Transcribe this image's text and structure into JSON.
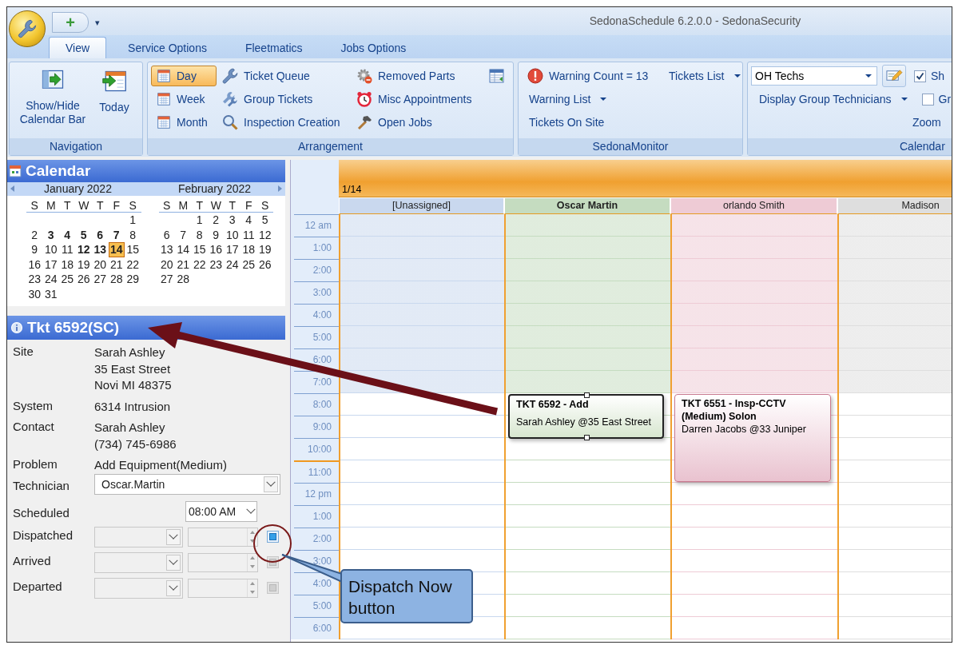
{
  "window": {
    "title": "SedonaSchedule 6.2.0.0 - SedonaSecurity"
  },
  "quick_access": {
    "add_label": "+",
    "customize_label": "▾"
  },
  "tabs": [
    {
      "label": "View",
      "selected": true
    },
    {
      "label": "Service Options",
      "selected": false
    },
    {
      "label": "Fleetmatics",
      "selected": false
    },
    {
      "label": "Jobs Options",
      "selected": false
    }
  ],
  "ribbon": {
    "navigation": {
      "label": "Navigation",
      "buttons": [
        "Show/Hide Calendar Bar",
        "Today"
      ]
    },
    "arrangement": {
      "label": "Arrangement",
      "views": [
        {
          "label": "Day",
          "selected": true
        },
        {
          "label": "Week",
          "selected": false
        },
        {
          "label": "Month",
          "selected": false
        }
      ],
      "actions": [
        "Ticket Queue",
        "Group Tickets",
        "Inspection Creation",
        "Removed Parts",
        "Misc Appointments",
        "Open Jobs"
      ]
    },
    "monitor": {
      "label": "SedonaMonitor",
      "warning_count": "Warning Count = 13",
      "tickets_list": "Tickets List",
      "warning_list": "Warning List",
      "tickets_on_site": "Tickets On Site"
    },
    "calendar": {
      "label": "Calendar",
      "group_combo": "OH Techs",
      "display_group": "Display Group Technicians",
      "zoom": "Zoom",
      "options": [
        {
          "label": "Sh",
          "checked": true
        },
        {
          "label": "Gr",
          "checked": false
        }
      ]
    }
  },
  "calendar_panel": {
    "title": "Calendar",
    "months": [
      {
        "title": "January 2022",
        "weekdays": [
          "S",
          "M",
          "T",
          "W",
          "T",
          "F",
          "S"
        ],
        "weeks": [
          [
            {
              "day": "1",
              "bold": false,
              "selected": false
            }
          ],
          [
            {
              "day": "2",
              "bold": false,
              "selected": false
            },
            {
              "day": "3",
              "bold": true,
              "selected": false
            },
            {
              "day": "4",
              "bold": true,
              "selected": false
            },
            {
              "day": "5",
              "bold": true,
              "selected": false
            },
            {
              "day": "6",
              "bold": true,
              "selected": false
            },
            {
              "day": "7",
              "bold": true,
              "selected": false
            },
            {
              "day": "8",
              "bold": false,
              "selected": false
            }
          ],
          [
            {
              "day": "9",
              "bold": false,
              "selected": false
            },
            {
              "day": "10",
              "bold": false,
              "selected": false
            },
            {
              "day": "11",
              "bold": false,
              "selected": false
            },
            {
              "day": "12",
              "bold": true,
              "selected": false
            },
            {
              "day": "13",
              "bold": true,
              "selected": false
            },
            {
              "day": "14",
              "bold": true,
              "selected": true
            },
            {
              "day": "15",
              "bold": false,
              "selected": false
            }
          ],
          [
            {
              "day": "16",
              "bold": false,
              "selected": false
            },
            {
              "day": "17",
              "bold": false,
              "selected": false
            },
            {
              "day": "18",
              "bold": false,
              "selected": false
            },
            {
              "day": "19",
              "bold": false,
              "selected": false
            },
            {
              "day": "20",
              "bold": false,
              "selected": false
            },
            {
              "day": "21",
              "bold": false,
              "selected": false
            },
            {
              "day": "22",
              "bold": false,
              "selected": false
            }
          ],
          [
            {
              "day": "23",
              "bold": false,
              "selected": false
            },
            {
              "day": "24",
              "bold": false,
              "selected": false
            },
            {
              "day": "25",
              "bold": false,
              "selected": false
            },
            {
              "day": "26",
              "bold": false,
              "selected": false
            },
            {
              "day": "27",
              "bold": false,
              "selected": false
            },
            {
              "day": "28",
              "bold": false,
              "selected": false
            },
            {
              "day": "29",
              "bold": false,
              "selected": false
            }
          ],
          [
            {
              "day": "30",
              "bold": false,
              "selected": false
            },
            {
              "day": "31",
              "bold": false,
              "selected": false
            }
          ]
        ]
      },
      {
        "title": "February 2022",
        "weekdays": [
          "S",
          "M",
          "T",
          "W",
          "T",
          "F",
          "S"
        ],
        "weeks": [
          [
            {
              "day": "1",
              "bold": false,
              "selected": false
            },
            {
              "day": "2",
              "bold": false,
              "selected": false
            },
            {
              "day": "3",
              "bold": false,
              "selected": false
            },
            {
              "day": "4",
              "bold": false,
              "selected": false
            },
            {
              "day": "5",
              "bold": false,
              "selected": false
            }
          ],
          [
            {
              "day": "6",
              "bold": false,
              "selected": false
            },
            {
              "day": "7",
              "bold": false,
              "selected": false
            },
            {
              "day": "8",
              "bold": false,
              "selected": false
            },
            {
              "day": "9",
              "bold": false,
              "selected": false
            },
            {
              "day": "10",
              "bold": false,
              "selected": false
            },
            {
              "day": "11",
              "bold": false,
              "selected": false
            },
            {
              "day": "12",
              "bold": false,
              "selected": false
            }
          ],
          [
            {
              "day": "13",
              "bold": false,
              "selected": false
            },
            {
              "day": "14",
              "bold": false,
              "selected": false
            },
            {
              "day": "15",
              "bold": false,
              "selected": false
            },
            {
              "day": "16",
              "bold": false,
              "selected": false
            },
            {
              "day": "17",
              "bold": false,
              "selected": false
            },
            {
              "day": "18",
              "bold": false,
              "selected": false
            },
            {
              "day": "19",
              "bold": false,
              "selected": false
            }
          ],
          [
            {
              "day": "20",
              "bold": false,
              "selected": false
            },
            {
              "day": "21",
              "bold": false,
              "selected": false
            },
            {
              "day": "22",
              "bold": false,
              "selected": false
            },
            {
              "day": "23",
              "bold": false,
              "selected": false
            },
            {
              "day": "24",
              "bold": false,
              "selected": false
            },
            {
              "day": "25",
              "bold": false,
              "selected": false
            },
            {
              "day": "26",
              "bold": false,
              "selected": false
            }
          ],
          [
            {
              "day": "27",
              "bold": false,
              "selected": false
            },
            {
              "day": "28",
              "bold": false,
              "selected": false
            }
          ]
        ]
      }
    ]
  },
  "ticket": {
    "title": "Tkt 6592(SC)",
    "details": [
      {
        "label": "Site",
        "lines": [
          "Sarah Ashley",
          "35 East Street",
          "Novi MI 48375"
        ]
      },
      {
        "label": "System",
        "lines": [
          "6314 Intrusion"
        ]
      },
      {
        "label": "Contact",
        "lines": [
          "Sarah Ashley",
          "(734) 745-6986"
        ]
      },
      {
        "label": "Problem",
        "lines": [
          "Add Equipment(Medium)"
        ]
      }
    ],
    "technician": {
      "label": "Technician",
      "value": "Oscar.Martin"
    },
    "scheduled": {
      "label": "Scheduled",
      "time": "08:00 AM"
    },
    "status_rows": [
      {
        "label": "Dispatched",
        "disabled": false
      },
      {
        "label": "Arrived",
        "disabled": true
      },
      {
        "label": "Departed",
        "disabled": true
      }
    ]
  },
  "schedule": {
    "date": "1/14",
    "times": [
      "12 am",
      "1:00",
      "2:00",
      "3:00",
      "4:00",
      "5:00",
      "6:00",
      "7:00",
      "8:00",
      "9:00",
      "10:00",
      "11:00",
      "12 pm",
      "1:00",
      "2:00",
      "3:00",
      "4:00",
      "5:00",
      "6:00"
    ],
    "resources": [
      {
        "name": "[Unassigned]",
        "color": "#c9d8ee",
        "selected": false
      },
      {
        "name": "Oscar Martin",
        "color": "#c5dcc0",
        "selected": true,
        "appointments": [
          {
            "title": "TKT 6592 - Add",
            "subtitle": "Sarah Ashley @35 East Street",
            "selected": true
          }
        ]
      },
      {
        "name": "orlando Smith",
        "color": "#eecbd5",
        "selected": false,
        "appointments": [
          {
            "title": "TKT 6551 - Insp-CCTV (Medium) Solon",
            "subtitle": "Darren Jacobs @33 Juniper",
            "selected": false
          }
        ]
      },
      {
        "name": "Madison",
        "color": "#dedede",
        "selected": false
      }
    ]
  },
  "callout": {
    "text": "Dispatch Now button"
  }
}
